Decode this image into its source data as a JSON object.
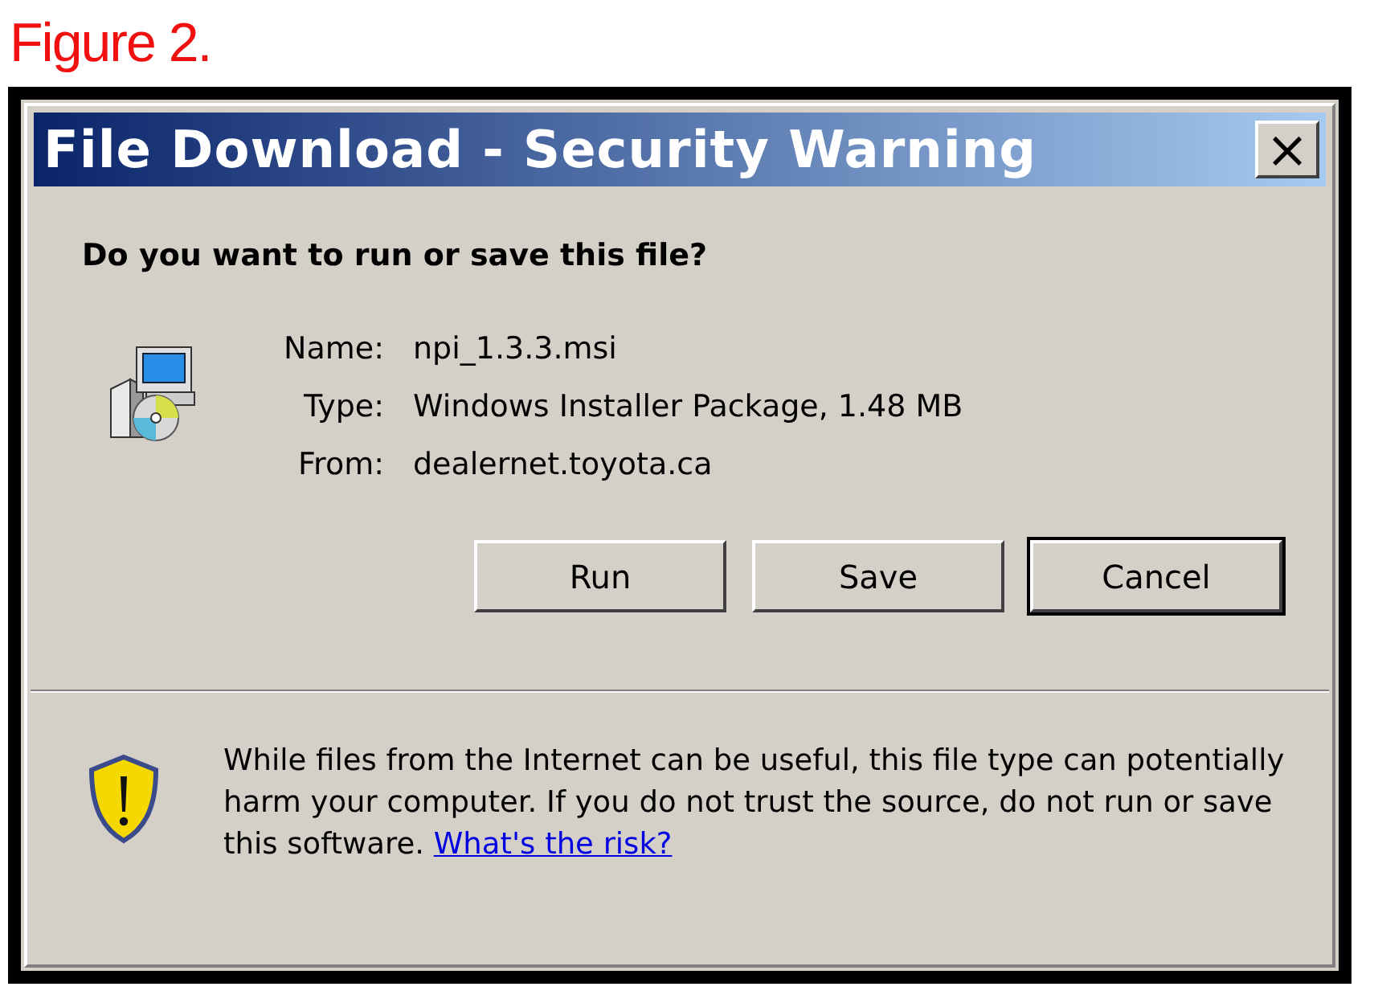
{
  "caption": "Figure 2.",
  "window": {
    "title": "File Download - Security Warning",
    "close": "×"
  },
  "question": "Do you want to run or save this file?",
  "fields": [
    {
      "label": "Name:",
      "value": "npi_1.3.3.msi"
    },
    {
      "label": "Type:",
      "value": "Windows Installer Package, 1.48 MB"
    },
    {
      "label": "From:",
      "value": "dealernet.toyota.ca"
    }
  ],
  "buttons": [
    {
      "label": "Run",
      "default": false
    },
    {
      "label": "Save",
      "default": false
    },
    {
      "label": "Cancel",
      "default": true
    }
  ],
  "warning": {
    "text": "While files from the Internet can be useful, this file type can potentially harm your computer. If you do not trust the source, do not run or save this software.",
    "link": "What's the risk?"
  }
}
